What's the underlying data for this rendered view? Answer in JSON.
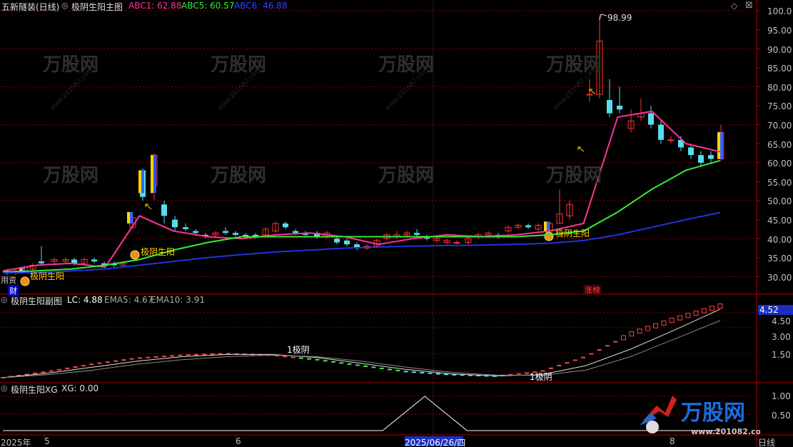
{
  "main_header": {
    "stock_name": "五新隧装(日线)",
    "indicator_name": "极阴生阳主图",
    "abc1": "ABC1: 62.88",
    "abc5": "ABC5: 60.57",
    "abc6": "ABC6: 46.88"
  },
  "sub_header": {
    "indicator_name": "极阴生阳副图",
    "lc": "LC: 4.88",
    "ema5": "EMA5: 4.67",
    "ema10": "EMA10: 3.91"
  },
  "xg_header": {
    "indicator_name": "极阴生阳XG",
    "xg": "XG: 0.00"
  },
  "main_y_ticks": [
    "100.0",
    "95.00",
    "90.00",
    "85.00",
    "80.00",
    "75.00",
    "70.00",
    "65.00",
    "60.00",
    "55.00",
    "50.00",
    "45.00",
    "40.00",
    "35.00",
    "30.00"
  ],
  "sub_y_ticks": [
    "4.50",
    "3.00",
    "1.50"
  ],
  "sub_current_value": "4.52",
  "xg_y_ticks": [
    "1.00",
    "0.50"
  ],
  "x_labels": {
    "year": "2025年",
    "m5": "5",
    "m6": "6",
    "m8": "8",
    "crosshair_date": "2025/06/26/四",
    "period": "日线"
  },
  "annotations": {
    "high_price": "98.99",
    "signal_label": "极阴生阳",
    "zhang_bang": "涨榜",
    "cai": "财",
    "left_note": "用资",
    "sub_label_1": "1极阴",
    "sub_label_2": "1极阴"
  },
  "watermark": {
    "brand": "万股网",
    "url": "www.201082.com"
  },
  "colors": {
    "abc1": "#ff3399",
    "abc5": "#33ee33",
    "abc6": "#2233dd",
    "up_candle": "#ff3333",
    "down_candle": "#55ddee",
    "signal": "#ffd400",
    "grid": "#8b0000",
    "axis_text": "#c0c0c0"
  },
  "chart_data": [
    {
      "type": "line",
      "title": "极阴生阳主图",
      "x": [
        "2025-05",
        "2025-06",
        "2025-07",
        "2025-08"
      ],
      "ylim": [
        27,
        101
      ],
      "series": [
        {
          "name": "ABC1",
          "values": [
            31.5,
            33,
            33.5,
            32.5,
            46,
            42,
            40.5,
            40,
            41,
            41.5,
            40.5,
            38.5,
            40,
            41,
            40.5,
            41,
            42,
            44,
            72,
            73.5,
            65,
            62.88
          ]
        },
        {
          "name": "ABC5",
          "values": [
            31.2,
            31.5,
            32,
            33,
            34.5,
            37,
            39,
            40.5,
            40.5,
            40.5,
            40.5,
            40.5,
            40.5,
            40.5,
            40.5,
            40.5,
            41,
            42,
            47,
            53,
            58,
            60.57
          ]
        },
        {
          "name": "ABC6",
          "values": [
            31,
            31,
            31.5,
            32,
            33,
            34,
            35,
            35.8,
            36.5,
            37,
            37.5,
            37.8,
            38,
            38.2,
            38.3,
            38.5,
            38.8,
            39.5,
            41,
            43,
            45,
            46.88
          ]
        }
      ],
      "high_label": 98.99
    },
    {
      "type": "line",
      "title": "极阴生阳副图",
      "series": [
        {
          "name": "LC",
          "values": [
            0.1,
            0.5,
            1.0,
            1.4,
            1.6,
            1.7,
            1.6,
            1.3,
            0.9,
            0.5,
            0.3,
            0.2,
            0.5,
            1.5,
            3.0,
            4.0,
            4.88
          ]
        },
        {
          "name": "EMA5",
          "values": [
            0.1,
            0.4,
            0.8,
            1.2,
            1.5,
            1.65,
            1.65,
            1.45,
            1.05,
            0.65,
            0.35,
            0.22,
            0.3,
            0.9,
            2.0,
            3.3,
            4.67
          ]
        },
        {
          "name": "EMA10",
          "values": [
            0.1,
            0.3,
            0.6,
            1.0,
            1.3,
            1.5,
            1.6,
            1.5,
            1.2,
            0.8,
            0.45,
            0.27,
            0.25,
            0.6,
            1.5,
            2.7,
            3.91
          ]
        }
      ],
      "ylim": [
        0,
        5
      ]
    },
    {
      "type": "line",
      "title": "极阴生阳XG",
      "series": [
        {
          "name": "XG",
          "values": [
            0,
            0,
            0,
            0,
            0,
            0,
            0,
            0,
            0,
            0,
            1,
            0,
            0,
            0,
            0,
            0,
            0,
            0
          ]
        }
      ],
      "ylim": [
        0,
        1.2
      ]
    }
  ]
}
